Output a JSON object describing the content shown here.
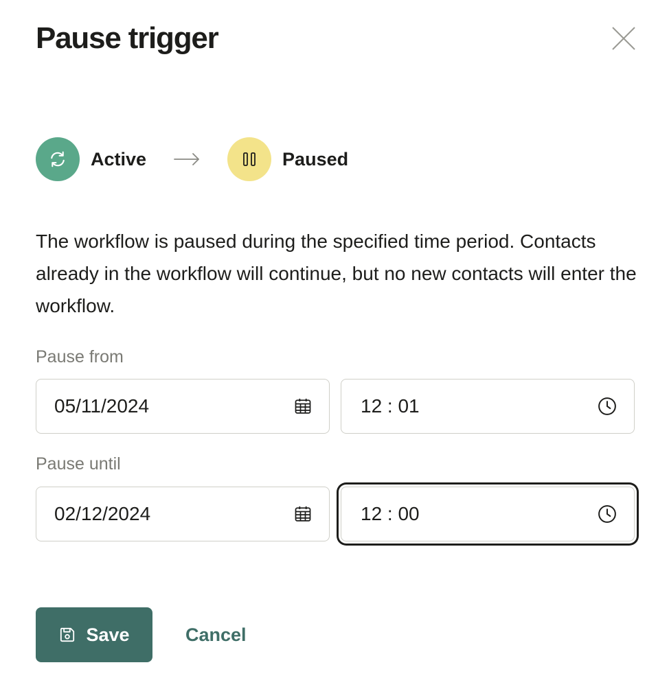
{
  "dialog": {
    "title": "Pause trigger"
  },
  "status": {
    "from_label": "Active",
    "to_label": "Paused",
    "active_color": "#5aa88a",
    "paused_color": "#f3e38a"
  },
  "description": "The workflow is paused during the specified time period. Contacts already in the workflow will continue, but no new contacts will enter the workflow.",
  "pause_from": {
    "label": "Pause from",
    "date": "05/11/2024",
    "time": "12 : 01"
  },
  "pause_until": {
    "label": "Pause until",
    "date": "02/12/2024",
    "time": "12 : 00"
  },
  "actions": {
    "save_label": "Save",
    "cancel_label": "Cancel",
    "primary_color": "#3f6e67"
  },
  "icons": {
    "close": "close-icon",
    "active": "refresh-icon",
    "arrow": "arrow-right-icon",
    "paused": "pause-icon",
    "date": "calendar-icon",
    "time": "clock-icon",
    "save": "floppy-disk-icon"
  }
}
